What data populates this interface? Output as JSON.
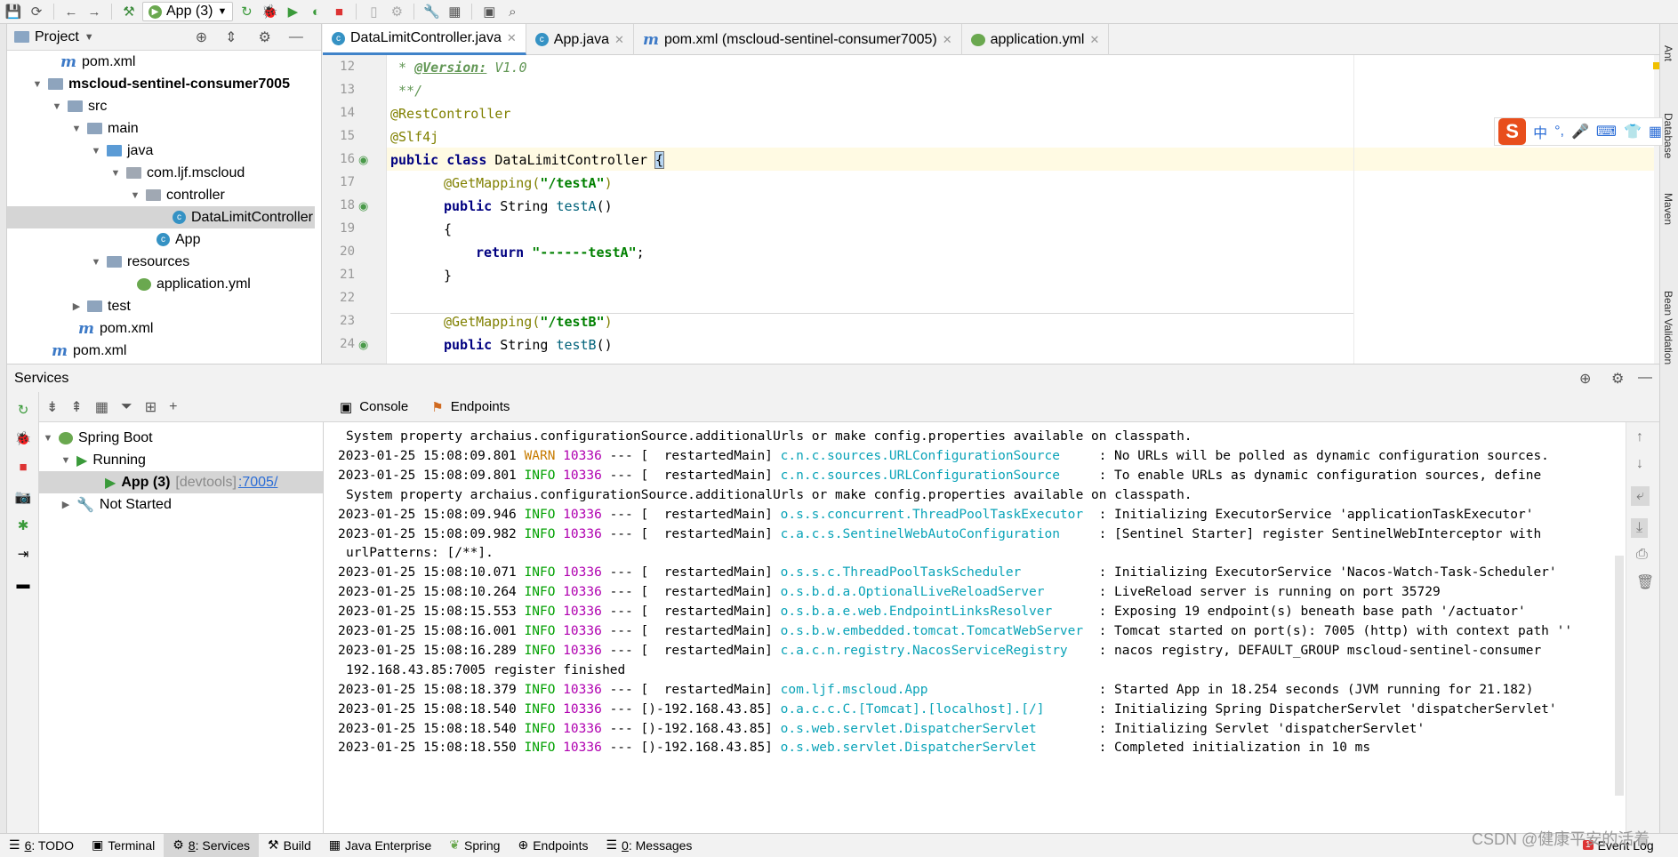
{
  "toolbar": {
    "run_config": "App (3)"
  },
  "project_panel": {
    "title": "Project",
    "tree": [
      {
        "label": "pom.xml",
        "icon": "m"
      },
      {
        "label": "mscloud-sentinel-consumer7005",
        "icon": "module"
      },
      {
        "label": "src",
        "icon": "folder"
      },
      {
        "label": "main",
        "icon": "folder"
      },
      {
        "label": "java",
        "icon": "folder"
      },
      {
        "label": "com.ljf.mscloud",
        "icon": "package"
      },
      {
        "label": "controller",
        "icon": "package"
      },
      {
        "label": "DataLimitController",
        "icon": "class"
      },
      {
        "label": "App",
        "icon": "class"
      },
      {
        "label": "resources",
        "icon": "folder"
      },
      {
        "label": "application.yml",
        "icon": "yml"
      },
      {
        "label": "test",
        "icon": "folder"
      },
      {
        "label": "pom.xml",
        "icon": "m"
      },
      {
        "label": "pom.xml",
        "icon": "m"
      }
    ]
  },
  "editor": {
    "tabs": [
      {
        "label": "DataLimitController.java",
        "active": true
      },
      {
        "label": "App.java",
        "active": false
      },
      {
        "label": "pom.xml (mscloud-sentinel-consumer7005)",
        "active": false
      },
      {
        "label": "application.yml",
        "active": false
      }
    ],
    "line_numbers": [
      "12",
      "13",
      "14",
      "15",
      "16",
      "17",
      "18",
      "19",
      "20",
      "21",
      "22",
      "23",
      "24"
    ],
    "code": {
      "l12_a": " * ",
      "l12_b": "@Version:",
      "l12_c": " V1.0",
      "l13": " **/",
      "l14": "@RestController",
      "l15": "@Slf4j",
      "l16_a": "public class ",
      "l16_b": "DataLimitController ",
      "l16_c": "{",
      "l17_a": "@GetMapping(",
      "l17_b": "\"/testA\"",
      "l17_c": ")",
      "l18_a": "public ",
      "l18_b": "String ",
      "l18_c": "testA",
      "l18_d": "()",
      "l19": "{",
      "l20_a": "return ",
      "l20_b": "\"------testA\"",
      "l20_c": ";",
      "l21": "}",
      "l23_a": "@GetMapping(",
      "l23_b": "\"/testB\"",
      "l23_c": ")",
      "l24_a": "public ",
      "l24_b": "String ",
      "l24_c": "testB",
      "l24_d": "()"
    }
  },
  "ime": {
    "zh": "中",
    "punct": "°,"
  },
  "services": {
    "title": "Services",
    "tree": {
      "spring_boot": "Spring Boot",
      "running": "Running",
      "app": "App (3)",
      "devtools": "[devtools]",
      "port": ":7005/",
      "not_started": "Not Started"
    },
    "tabs": {
      "console": "Console",
      "endpoints": "Endpoints"
    }
  },
  "console": {
    "lines": [
      {
        "type": "cont",
        "text": "System property archaius.configurationSource.additionalUrls or make config.properties available on classpath."
      },
      {
        "type": "log",
        "ts": "2023-01-25 15:08:09.801",
        "level": "WARN",
        "pid": "10336",
        "sep": " --- [",
        "thread": "  restartedMain]",
        "logger": "c.n.c.sources.URLConfigurationSource    ",
        "msg": " : No URLs will be polled as dynamic configuration sources."
      },
      {
        "type": "log",
        "ts": "2023-01-25 15:08:09.801",
        "level": "INFO",
        "pid": "10336",
        "sep": " --- [",
        "thread": "  restartedMain]",
        "logger": "c.n.c.sources.URLConfigurationSource    ",
        "msg": " : To enable URLs as dynamic configuration sources, define"
      },
      {
        "type": "cont",
        "text": "System property archaius.configurationSource.additionalUrls or make config.properties available on classpath."
      },
      {
        "type": "log",
        "ts": "2023-01-25 15:08:09.946",
        "level": "INFO",
        "pid": "10336",
        "sep": " --- [",
        "thread": "  restartedMain]",
        "logger": "o.s.s.concurrent.ThreadPoolTaskExecutor ",
        "msg": " : Initializing ExecutorService 'applicationTaskExecutor'"
      },
      {
        "type": "log",
        "ts": "2023-01-25 15:08:09.982",
        "level": "INFO",
        "pid": "10336",
        "sep": " --- [",
        "thread": "  restartedMain]",
        "logger": "c.a.c.s.SentinelWebAutoConfiguration    ",
        "msg": " : [Sentinel Starter] register SentinelWebInterceptor with"
      },
      {
        "type": "cont",
        "text": "urlPatterns: [/**]."
      },
      {
        "type": "log",
        "ts": "2023-01-25 15:08:10.071",
        "level": "INFO",
        "pid": "10336",
        "sep": " --- [",
        "thread": "  restartedMain]",
        "logger": "o.s.s.c.ThreadPoolTaskScheduler         ",
        "msg": " : Initializing ExecutorService 'Nacos-Watch-Task-Scheduler'"
      },
      {
        "type": "log",
        "ts": "2023-01-25 15:08:10.264",
        "level": "INFO",
        "pid": "10336",
        "sep": " --- [",
        "thread": "  restartedMain]",
        "logger": "o.s.b.d.a.OptionalLiveReloadServer      ",
        "msg": " : LiveReload server is running on port 35729"
      },
      {
        "type": "log",
        "ts": "2023-01-25 15:08:15.553",
        "level": "INFO",
        "pid": "10336",
        "sep": " --- [",
        "thread": "  restartedMain]",
        "logger": "o.s.b.a.e.web.EndpointLinksResolver     ",
        "msg": " : Exposing 19 endpoint(s) beneath base path '/actuator'"
      },
      {
        "type": "log",
        "ts": "2023-01-25 15:08:16.001",
        "level": "INFO",
        "pid": "10336",
        "sep": " --- [",
        "thread": "  restartedMain]",
        "logger": "o.s.b.w.embedded.tomcat.TomcatWebServer ",
        "msg": " : Tomcat started on port(s): 7005 (http) with context path ''"
      },
      {
        "type": "log",
        "ts": "2023-01-25 15:08:16.289",
        "level": "INFO",
        "pid": "10336",
        "sep": " --- [",
        "thread": "  restartedMain]",
        "logger": "c.a.c.n.registry.NacosServiceRegistry   ",
        "msg": " : nacos registry, DEFAULT_GROUP mscloud-sentinel-consumer"
      },
      {
        "type": "cont",
        "text": "192.168.43.85:7005 register finished"
      },
      {
        "type": "log",
        "ts": "2023-01-25 15:08:18.379",
        "level": "INFO",
        "pid": "10336",
        "sep": " --- [",
        "thread": "  restartedMain]",
        "logger": "com.ljf.mscloud.App                     ",
        "msg": " : Started App in 18.254 seconds (JVM running for 21.182)"
      },
      {
        "type": "log",
        "ts": "2023-01-25 15:08:18.540",
        "level": "INFO",
        "pid": "10336",
        "sep": " --- [",
        "thread": ")-192.168.43.85]",
        "logger": "o.a.c.c.C.[Tomcat].[localhost].[/]      ",
        "msg": " : Initializing Spring DispatcherServlet 'dispatcherServlet'"
      },
      {
        "type": "log",
        "ts": "2023-01-25 15:08:18.540",
        "level": "INFO",
        "pid": "10336",
        "sep": " --- [",
        "thread": ")-192.168.43.85]",
        "logger": "o.s.web.servlet.DispatcherServlet       ",
        "msg": " : Initializing Servlet 'dispatcherServlet'"
      },
      {
        "type": "log",
        "ts": "2023-01-25 15:08:18.550",
        "level": "INFO",
        "pid": "10336",
        "sep": " --- [",
        "thread": ")-192.168.43.85]",
        "logger": "o.s.web.servlet.DispatcherServlet       ",
        "msg": " : Completed initialization in 10 ms"
      }
    ]
  },
  "statusbar": {
    "todo_num": "6",
    "todo": ": TODO",
    "terminal": "Terminal",
    "services_num": "8",
    "services": ": Services",
    "build": "Build",
    "java_enterprise": "Java Enterprise",
    "spring": "Spring",
    "endpoints": "Endpoints",
    "messages_num": "0",
    "messages": ": Messages",
    "event_log": "Event Log"
  },
  "right_stripe": {
    "ant": "Ant",
    "database": "Database",
    "maven": "Maven",
    "bean_validation": "Bean Validation"
  },
  "watermark": "CSDN @健康平安的活着",
  "colors": {
    "accent": "#4083c9",
    "warn": "#c77b00",
    "info": "#00a000",
    "logger": "#0aa3b8",
    "pid": "#b000b0"
  }
}
